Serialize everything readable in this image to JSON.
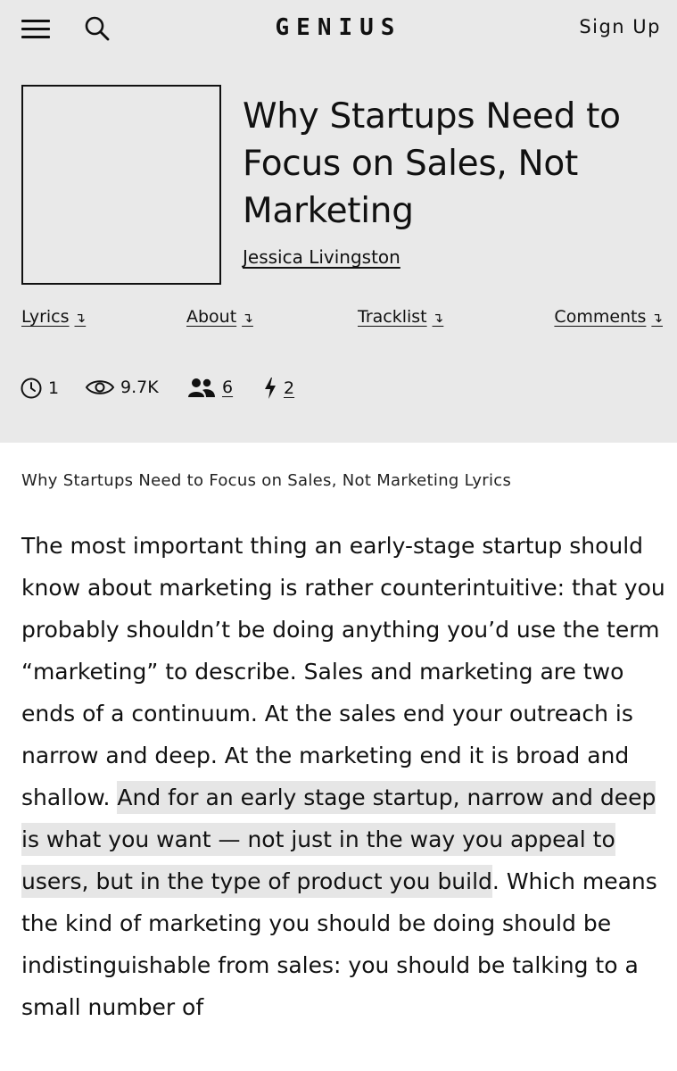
{
  "nav": {
    "logo": "GENIUS",
    "sign_up": "Sign Up"
  },
  "song": {
    "title": "Why Startups Need to Focus on Sales, Not Marketing",
    "artist": "Jessica Livingston"
  },
  "tabs": [
    {
      "label": "Lyrics",
      "arrow": "↴"
    },
    {
      "label": "About",
      "arrow": "↴"
    },
    {
      "label": "Tracklist",
      "arrow": "↴"
    },
    {
      "label": "Comments",
      "arrow": "↴"
    }
  ],
  "stats": {
    "annotations": "1",
    "views": "9.7K",
    "contributors": "6",
    "pyongs": "2"
  },
  "lyrics": {
    "heading": "Why Startups Need to Focus on Sales, Not Marketing Lyrics",
    "text_before": "The most important thing an early-stage startup should know about marketing is rather counterintuitive: that you probably shouldn’t be doing anything you’d use the term “marketing” to describe. Sales and marketing are two ends of a continuum. At the sales end your outreach is narrow and deep. At the marketing end it is broad and shallow. ",
    "highlighted": "And for an early stage startup, narrow and deep is what you want — not just in the way you appeal to users, but in the type of product you build",
    "text_after": ". Which means the kind of marketing you should be doing should be indistinguishable from sales: you should be talking to a small number of"
  }
}
